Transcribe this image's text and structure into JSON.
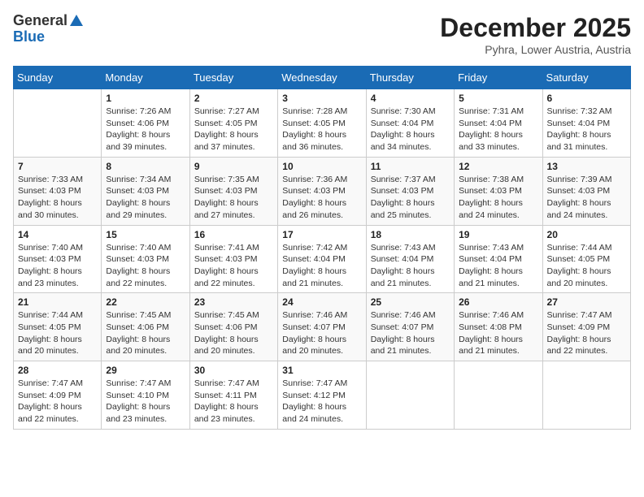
{
  "logo": {
    "line1": "General",
    "line2": "Blue"
  },
  "header": {
    "month": "December 2025",
    "location": "Pyhra, Lower Austria, Austria"
  },
  "weekdays": [
    "Sunday",
    "Monday",
    "Tuesday",
    "Wednesday",
    "Thursday",
    "Friday",
    "Saturday"
  ],
  "weeks": [
    [
      {
        "day": "",
        "info": ""
      },
      {
        "day": "1",
        "info": "Sunrise: 7:26 AM\nSunset: 4:06 PM\nDaylight: 8 hours\nand 39 minutes."
      },
      {
        "day": "2",
        "info": "Sunrise: 7:27 AM\nSunset: 4:05 PM\nDaylight: 8 hours\nand 37 minutes."
      },
      {
        "day": "3",
        "info": "Sunrise: 7:28 AM\nSunset: 4:05 PM\nDaylight: 8 hours\nand 36 minutes."
      },
      {
        "day": "4",
        "info": "Sunrise: 7:30 AM\nSunset: 4:04 PM\nDaylight: 8 hours\nand 34 minutes."
      },
      {
        "day": "5",
        "info": "Sunrise: 7:31 AM\nSunset: 4:04 PM\nDaylight: 8 hours\nand 33 minutes."
      },
      {
        "day": "6",
        "info": "Sunrise: 7:32 AM\nSunset: 4:04 PM\nDaylight: 8 hours\nand 31 minutes."
      }
    ],
    [
      {
        "day": "7",
        "info": "Sunrise: 7:33 AM\nSunset: 4:03 PM\nDaylight: 8 hours\nand 30 minutes."
      },
      {
        "day": "8",
        "info": "Sunrise: 7:34 AM\nSunset: 4:03 PM\nDaylight: 8 hours\nand 29 minutes."
      },
      {
        "day": "9",
        "info": "Sunrise: 7:35 AM\nSunset: 4:03 PM\nDaylight: 8 hours\nand 27 minutes."
      },
      {
        "day": "10",
        "info": "Sunrise: 7:36 AM\nSunset: 4:03 PM\nDaylight: 8 hours\nand 26 minutes."
      },
      {
        "day": "11",
        "info": "Sunrise: 7:37 AM\nSunset: 4:03 PM\nDaylight: 8 hours\nand 25 minutes."
      },
      {
        "day": "12",
        "info": "Sunrise: 7:38 AM\nSunset: 4:03 PM\nDaylight: 8 hours\nand 24 minutes."
      },
      {
        "day": "13",
        "info": "Sunrise: 7:39 AM\nSunset: 4:03 PM\nDaylight: 8 hours\nand 24 minutes."
      }
    ],
    [
      {
        "day": "14",
        "info": "Sunrise: 7:40 AM\nSunset: 4:03 PM\nDaylight: 8 hours\nand 23 minutes."
      },
      {
        "day": "15",
        "info": "Sunrise: 7:40 AM\nSunset: 4:03 PM\nDaylight: 8 hours\nand 22 minutes."
      },
      {
        "day": "16",
        "info": "Sunrise: 7:41 AM\nSunset: 4:03 PM\nDaylight: 8 hours\nand 22 minutes."
      },
      {
        "day": "17",
        "info": "Sunrise: 7:42 AM\nSunset: 4:04 PM\nDaylight: 8 hours\nand 21 minutes."
      },
      {
        "day": "18",
        "info": "Sunrise: 7:43 AM\nSunset: 4:04 PM\nDaylight: 8 hours\nand 21 minutes."
      },
      {
        "day": "19",
        "info": "Sunrise: 7:43 AM\nSunset: 4:04 PM\nDaylight: 8 hours\nand 21 minutes."
      },
      {
        "day": "20",
        "info": "Sunrise: 7:44 AM\nSunset: 4:05 PM\nDaylight: 8 hours\nand 20 minutes."
      }
    ],
    [
      {
        "day": "21",
        "info": "Sunrise: 7:44 AM\nSunset: 4:05 PM\nDaylight: 8 hours\nand 20 minutes."
      },
      {
        "day": "22",
        "info": "Sunrise: 7:45 AM\nSunset: 4:06 PM\nDaylight: 8 hours\nand 20 minutes."
      },
      {
        "day": "23",
        "info": "Sunrise: 7:45 AM\nSunset: 4:06 PM\nDaylight: 8 hours\nand 20 minutes."
      },
      {
        "day": "24",
        "info": "Sunrise: 7:46 AM\nSunset: 4:07 PM\nDaylight: 8 hours\nand 20 minutes."
      },
      {
        "day": "25",
        "info": "Sunrise: 7:46 AM\nSunset: 4:07 PM\nDaylight: 8 hours\nand 21 minutes."
      },
      {
        "day": "26",
        "info": "Sunrise: 7:46 AM\nSunset: 4:08 PM\nDaylight: 8 hours\nand 21 minutes."
      },
      {
        "day": "27",
        "info": "Sunrise: 7:47 AM\nSunset: 4:09 PM\nDaylight: 8 hours\nand 22 minutes."
      }
    ],
    [
      {
        "day": "28",
        "info": "Sunrise: 7:47 AM\nSunset: 4:09 PM\nDaylight: 8 hours\nand 22 minutes."
      },
      {
        "day": "29",
        "info": "Sunrise: 7:47 AM\nSunset: 4:10 PM\nDaylight: 8 hours\nand 23 minutes."
      },
      {
        "day": "30",
        "info": "Sunrise: 7:47 AM\nSunset: 4:11 PM\nDaylight: 8 hours\nand 23 minutes."
      },
      {
        "day": "31",
        "info": "Sunrise: 7:47 AM\nSunset: 4:12 PM\nDaylight: 8 hours\nand 24 minutes."
      },
      {
        "day": "",
        "info": ""
      },
      {
        "day": "",
        "info": ""
      },
      {
        "day": "",
        "info": ""
      }
    ]
  ]
}
